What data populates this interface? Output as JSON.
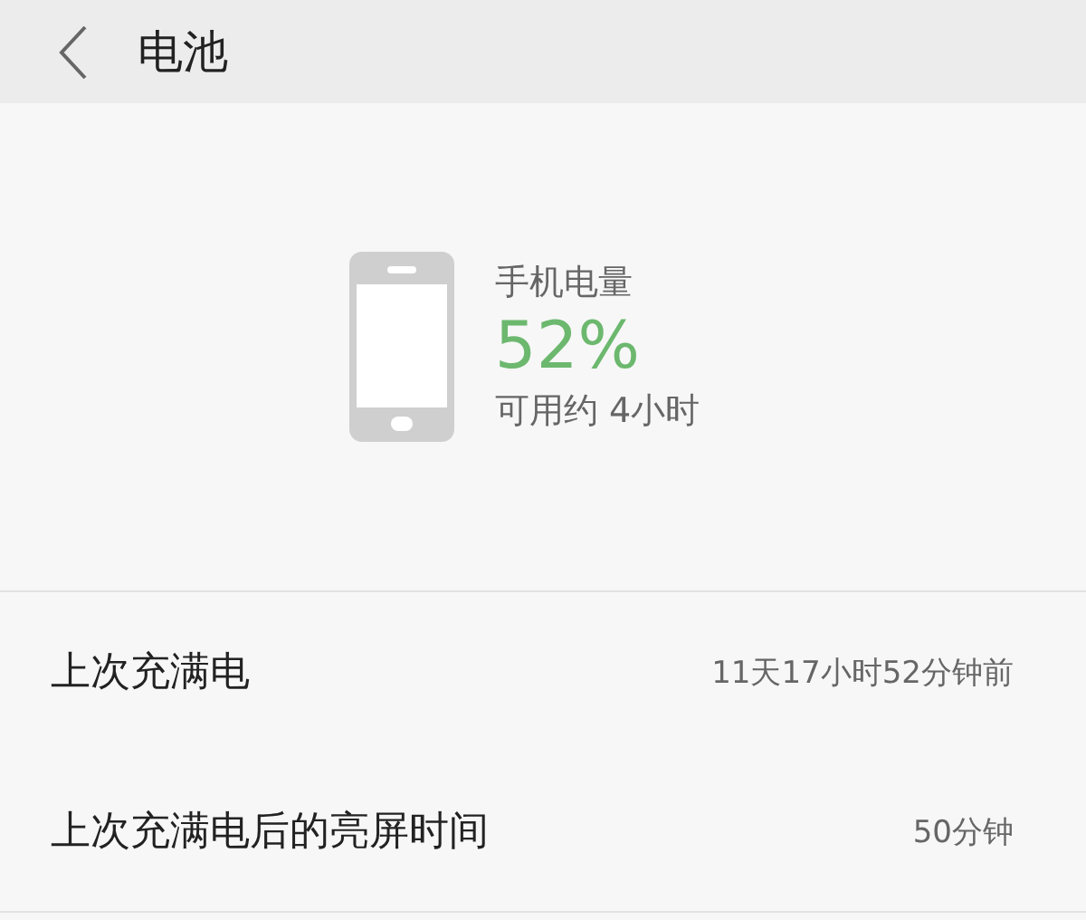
{
  "header": {
    "title": "电池"
  },
  "battery": {
    "label": "手机电量",
    "percent": "52%",
    "remaining": "可用约 4小时"
  },
  "rows": [
    {
      "label": "上次充满电",
      "value": "11天17小时52分钟前"
    },
    {
      "label": "上次充满电后的亮屏时间",
      "value": "50分钟"
    }
  ]
}
